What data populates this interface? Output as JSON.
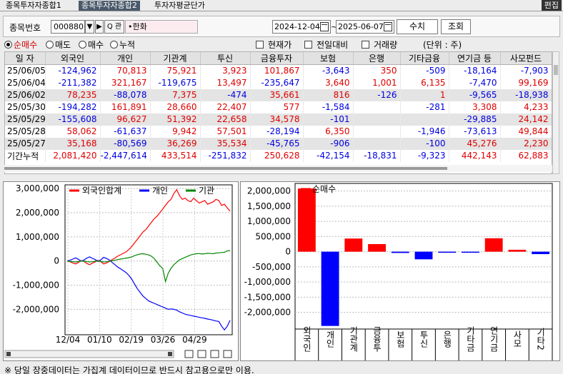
{
  "tabs": [
    {
      "label": "종목투자자종합1"
    },
    {
      "label": "종목투자자종합2"
    },
    {
      "label": "투자자평균단가"
    }
  ],
  "edit_label": "편집",
  "search": {
    "code_label": "종목번호",
    "code_value": "000880",
    "search_btn": "Q 관",
    "name_value": "•한화",
    "date_from": "2024-12-04",
    "date_sep": "~",
    "date_to": "2025-06-07",
    "btn_value": "수치",
    "btn_query": "조회"
  },
  "options": {
    "net_buy": "순매수",
    "sell": "매도",
    "buy": "매수",
    "cumulative": "누적",
    "current_price": "현재가",
    "prev_diff": "전일대비",
    "volume": "거래량",
    "unit": "(단위 : 주)"
  },
  "table": {
    "columns": [
      "일 자",
      "외국인",
      "개인",
      "기관계",
      "투신",
      "금융투자",
      "보험",
      "은행",
      "기타금융",
      "연기금 등",
      "사모펀드"
    ],
    "rows": [
      [
        "25/06/05",
        "-124,962",
        "70,813",
        "75,921",
        "3,923",
        "101,867",
        "-3,643",
        "350",
        "-509",
        "-18,164",
        "-7,903"
      ],
      [
        "25/06/04",
        "-211,382",
        "321,167",
        "-119,675",
        "13,497",
        "-235,647",
        "3,640",
        "1,001",
        "6,135",
        "-7,470",
        "99,169"
      ],
      [
        "25/06/02",
        "78,235",
        "-88,078",
        "7,375",
        "-474",
        "35,661",
        "816",
        "-126",
        "1",
        "-9,565",
        "-18,938"
      ],
      [
        "25/05/30",
        "-194,282",
        "161,891",
        "28,660",
        "22,407",
        "577",
        "-1,584",
        "",
        "-281",
        "3,308",
        "4,233"
      ],
      [
        "25/05/29",
        "-155,608",
        "96,627",
        "51,392",
        "22,658",
        "34,578",
        "-101",
        "",
        "",
        "-29,885",
        "24,142"
      ],
      [
        "25/05/28",
        "58,062",
        "-61,637",
        "9,942",
        "57,501",
        "-28,194",
        "6,350",
        "",
        "-1,946",
        "-73,613",
        "49,844"
      ],
      [
        "25/05/27",
        "35,168",
        "-80,569",
        "36,269",
        "35,534",
        "-45,765",
        "-906",
        "",
        "-100",
        "45,276",
        "2,230"
      ],
      [
        "기간누적",
        "2,081,420",
        "-2,447,614",
        "433,514",
        "-251,832",
        "250,628",
        "-42,154",
        "-18,831",
        "-9,323",
        "442,143",
        "62,883"
      ]
    ]
  },
  "chart_data": [
    {
      "type": "line",
      "title": "",
      "legend": [
        "외국인합계",
        "개인",
        "기관"
      ],
      "series_colors": [
        "#ff0000",
        "#0000ff",
        "#008800"
      ],
      "y_ticks": [
        "3,000,000",
        "2,000,000",
        "1,000,000",
        "0",
        "-1,000,000",
        "-2,000,000"
      ],
      "y_tick_values": [
        3000000,
        2000000,
        1000000,
        0,
        -1000000,
        -2000000
      ],
      "ylim": [
        -3050000,
        3150000
      ],
      "x_ticks": [
        "12/04",
        "01/10",
        "02/19",
        "03/26",
        "04/29"
      ],
      "series": [
        {
          "name": "외국인합계",
          "values": [
            0,
            -30000,
            -80000,
            -120000,
            -60000,
            20000,
            -20000,
            -100000,
            -150000,
            -90000,
            -40000,
            30000,
            -30000,
            -120000,
            -80000,
            -20000,
            60000,
            120000,
            200000,
            260000,
            320000,
            380000,
            480000,
            600000,
            750000,
            900000,
            1050000,
            1200000,
            1300000,
            1450000,
            1600000,
            1750000,
            1850000,
            2000000,
            2150000,
            2300000,
            2450000,
            2550000,
            2800000,
            2950000,
            2700000,
            2550000,
            2600000,
            2500000,
            2450000,
            2600000,
            2500000,
            2400000,
            2450000,
            2500000,
            2350000,
            2400000,
            2450000,
            2550000,
            2500000,
            2300000,
            2350000,
            2200000,
            2060000
          ]
        },
        {
          "name": "개인",
          "values": [
            0,
            30000,
            80000,
            130000,
            70000,
            -10000,
            40000,
            120000,
            170000,
            110000,
            60000,
            -20000,
            50000,
            150000,
            110000,
            40000,
            -60000,
            -150000,
            -250000,
            -320000,
            -400000,
            -480000,
            -600000,
            -750000,
            -950000,
            -1150000,
            -1300000,
            -1450000,
            -1550000,
            -1650000,
            -1700000,
            -1750000,
            -1800000,
            -1850000,
            -1900000,
            -1950000,
            -2000000,
            -1980000,
            -2000000,
            -2030000,
            -2100000,
            -2150000,
            -2200000,
            -2230000,
            -2250000,
            -2280000,
            -2300000,
            -2330000,
            -2350000,
            -2370000,
            -2400000,
            -2420000,
            -2450000,
            -2480000,
            -2500000,
            -2700000,
            -2850000,
            -2700000,
            -2450000
          ]
        },
        {
          "name": "기관",
          "values": [
            0,
            -20000,
            -30000,
            -40000,
            -20000,
            0,
            -10000,
            -30000,
            -40000,
            -30000,
            -10000,
            0,
            -20000,
            -40000,
            -30000,
            -10000,
            10000,
            30000,
            60000,
            80000,
            100000,
            120000,
            140000,
            170000,
            220000,
            260000,
            290000,
            300000,
            280000,
            250000,
            200000,
            100000,
            -50000,
            -200000,
            -300000,
            -850000,
            -500000,
            -300000,
            -150000,
            -50000,
            50000,
            100000,
            150000,
            200000,
            250000,
            280000,
            300000,
            310000,
            290000,
            300000,
            320000,
            310000,
            300000,
            330000,
            340000,
            350000,
            360000,
            420000,
            430000
          ]
        }
      ]
    },
    {
      "type": "bar",
      "title": "",
      "legend": [
        "순매수"
      ],
      "categories": [
        "외국인",
        "개인",
        "기관계",
        "금융투",
        "보험",
        "투신",
        "은행",
        "기타금",
        "연기금",
        "사모",
        "기타2"
      ],
      "values": [
        2081420,
        -2447614,
        433514,
        250628,
        -42154,
        -251832,
        -18831,
        -9323,
        442143,
        62883,
        -80000
      ],
      "colors": [
        "#ff0000",
        "#0000ff",
        "#ff0000",
        "#ff0000",
        "#0000ff",
        "#0000ff",
        "#0000ff",
        "#0000ff",
        "#ff0000",
        "#ff0000",
        "#0000ff"
      ],
      "y_ticks": [
        "2,000,000",
        "1,500,000",
        "1,000,000",
        "500,000",
        "0",
        "-500,000",
        "-1,000,000",
        "-1,500,000",
        "-2,000,000"
      ],
      "y_tick_values": [
        2000000,
        1500000,
        1000000,
        500000,
        0,
        -500000,
        -1000000,
        -1500000,
        -2000000
      ],
      "ylim": [
        -2550000,
        2250000
      ]
    }
  ],
  "footer": "※ 당일 장중데이터는 가집계 데이터이므로 반드시 참고용으로만 이용."
}
